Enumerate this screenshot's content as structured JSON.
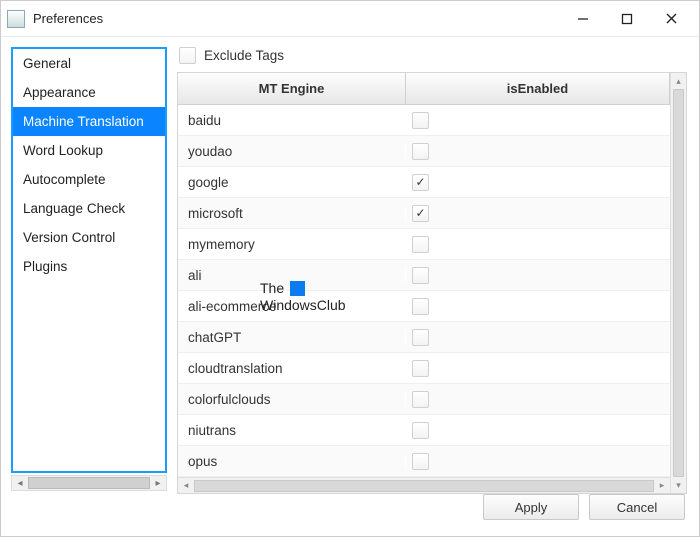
{
  "window": {
    "title": "Preferences"
  },
  "sidebar": {
    "items": [
      {
        "label": "General"
      },
      {
        "label": "Appearance"
      },
      {
        "label": "Machine Translation",
        "selected": true
      },
      {
        "label": "Word Lookup"
      },
      {
        "label": "Autocomplete"
      },
      {
        "label": "Language Check"
      },
      {
        "label": "Version Control"
      },
      {
        "label": "Plugins"
      }
    ]
  },
  "main": {
    "exclude_label": "Exclude Tags",
    "exclude_checked": false,
    "table": {
      "columns": [
        "MT Engine",
        "isEnabled"
      ],
      "rows": [
        {
          "engine": "baidu",
          "enabled": false
        },
        {
          "engine": "youdao",
          "enabled": false
        },
        {
          "engine": "google",
          "enabled": true
        },
        {
          "engine": "microsoft",
          "enabled": true
        },
        {
          "engine": "mymemory",
          "enabled": false
        },
        {
          "engine": "ali",
          "enabled": false
        },
        {
          "engine": "ali-ecommerce",
          "enabled": false
        },
        {
          "engine": "chatGPT",
          "enabled": false
        },
        {
          "engine": "cloudtranslation",
          "enabled": false
        },
        {
          "engine": "colorfulclouds",
          "enabled": false
        },
        {
          "engine": "niutrans",
          "enabled": false
        },
        {
          "engine": "opus",
          "enabled": false
        }
      ]
    }
  },
  "footer": {
    "apply": "Apply",
    "cancel": "Cancel"
  },
  "watermark": {
    "line1": "The",
    "line2": "WindowsClub"
  }
}
